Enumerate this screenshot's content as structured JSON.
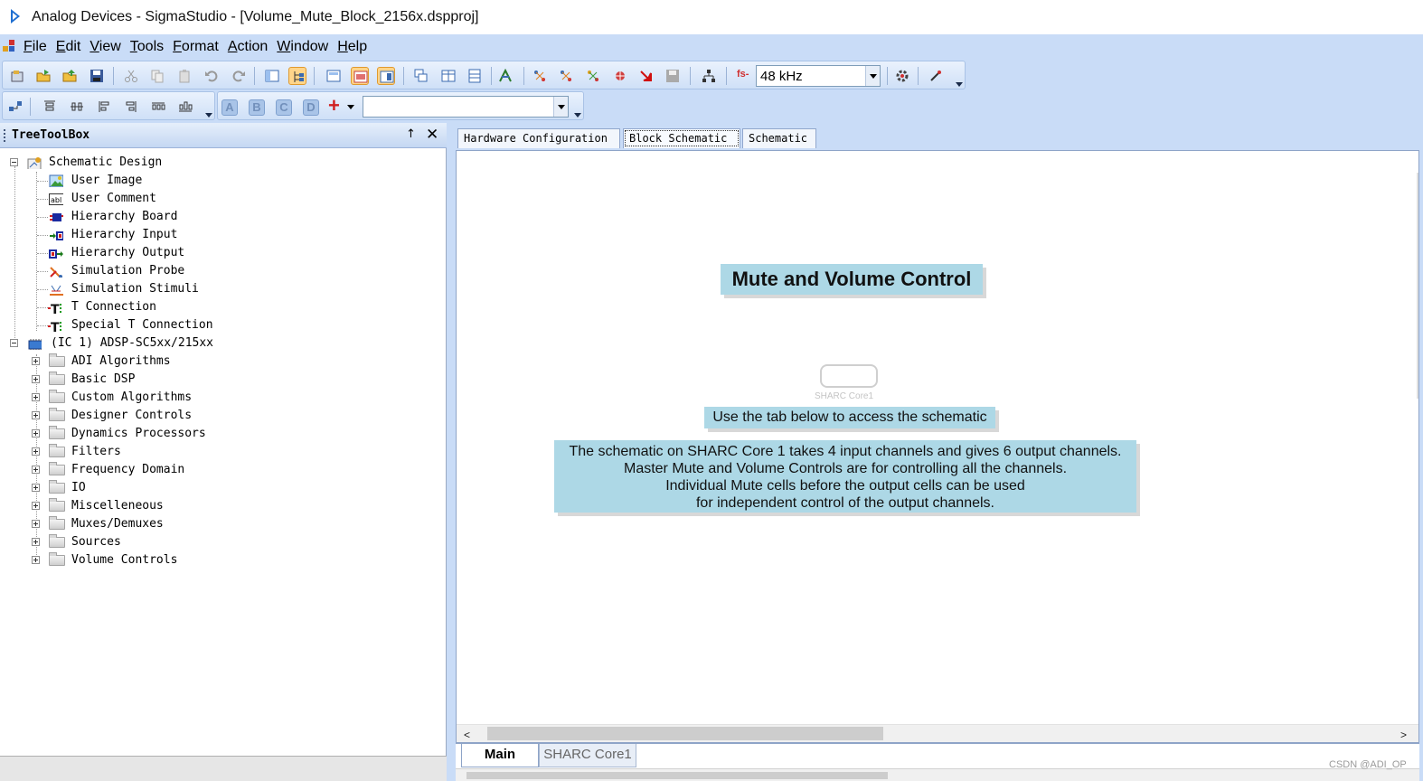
{
  "window": {
    "title": "Analog Devices - SigmaStudio - [Volume_Mute_Block_2156x.dspproj]"
  },
  "menu": [
    "File",
    "Edit",
    "View",
    "Tools",
    "Format",
    "Action",
    "Window",
    "Help"
  ],
  "toolbar": {
    "sample_rate": "48 kHz",
    "fs_label": "fs-",
    "format_letters": [
      "A",
      "B",
      "C",
      "D"
    ],
    "add_symbol": "+",
    "zoom_value": ""
  },
  "toolbox": {
    "title": "TreeToolBox",
    "pin_glyph": "↑",
    "close_glyph": "✕",
    "schematic_design": {
      "label": "Schematic Design",
      "children": [
        "User Image",
        "User Comment",
        "Hierarchy Board",
        "Hierarchy Input",
        "Hierarchy Output",
        "Simulation Probe",
        "Simulation Stimuli",
        "T Connection",
        "Special T Connection"
      ]
    },
    "ic": {
      "label": "(IC 1) ADSP-SC5xx/215xx",
      "children": [
        "ADI Algorithms",
        "Basic DSP",
        "Custom Algorithms",
        "Designer Controls",
        "Dynamics Processors",
        "Filters",
        "Frequency Domain",
        "IO",
        "Miscelleneous",
        "Muxes/Demuxes",
        "Sources",
        "Volume Controls"
      ]
    }
  },
  "doc_tabs": [
    "Hardware Configuration",
    "Block Schematic",
    "Schematic"
  ],
  "canvas": {
    "title": "Mute and Volume Control",
    "core_label": "SHARC Core1",
    "hint": "Use the tab below to access the schematic",
    "description": [
      "The schematic on SHARC Core 1 takes 4 input channels and gives 6 output channels.",
      "Master Mute and Volume Controls are for controlling all the channels.",
      "Individual Mute cells before the output cells can be used",
      "for independent control of the output channels."
    ]
  },
  "scroll": {
    "left_arrow": "<",
    "right_arrow": ">"
  },
  "sheet_tabs": [
    "Main",
    "SHARC Core1"
  ],
  "watermark": "CSDN @ADI_OP",
  "colors": {
    "chrome_blue": "#c9dcf7",
    "comment_fill": "#add8e6",
    "selected_button": "#ffd58a"
  }
}
